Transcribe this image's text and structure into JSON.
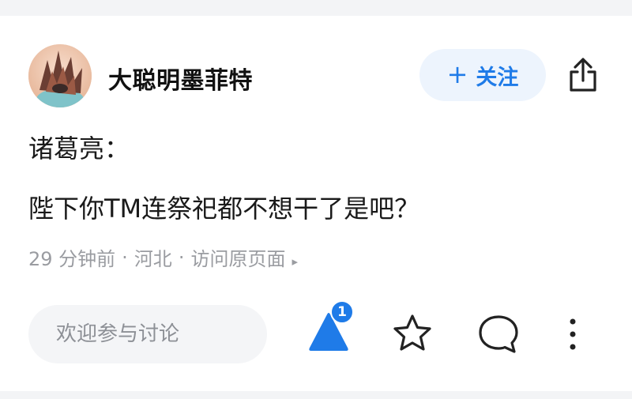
{
  "user": {
    "name": "大聪明墨菲特"
  },
  "follow": {
    "plus": "+",
    "label": "关注"
  },
  "post": {
    "lines": [
      "诸葛亮：",
      "陛下你TM连祭祀都不想干了是吧？"
    ]
  },
  "meta": {
    "time": "29 分钟前",
    "separator": "·",
    "location": "河北",
    "source": "访问原页面",
    "arrow": "▸"
  },
  "comment": {
    "placeholder": "欢迎参与讨论"
  },
  "actions": {
    "like_count": "1"
  },
  "colors": {
    "accent": "#1f7be8",
    "follow_bg": "#edf4fd",
    "meta_text": "#9a9ca1",
    "input_bg": "#f4f5f7"
  },
  "icons": [
    "share-icon",
    "like-triangle-icon",
    "star-icon",
    "comment-bubble-icon",
    "more-vertical-icon"
  ]
}
